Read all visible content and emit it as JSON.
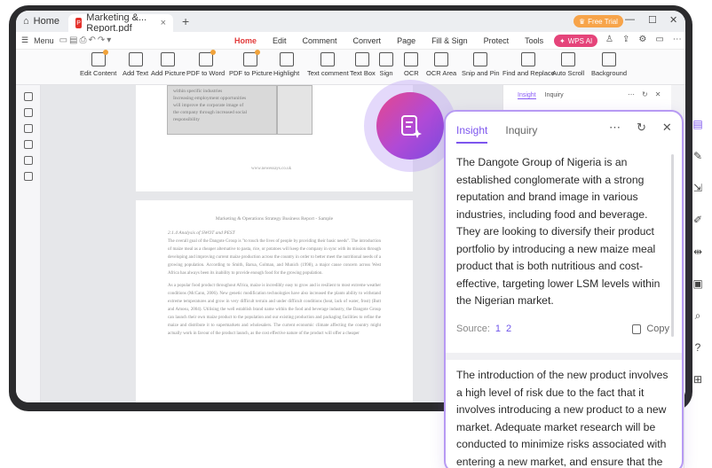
{
  "tabbar": {
    "home_label": "Home",
    "doc_tab_label": "Marketing &... Report.pdf",
    "free_trial": "Free Trial"
  },
  "menubar": {
    "menu_label": "Menu",
    "items": [
      "Home",
      "Edit",
      "Comment",
      "Convert",
      "Page",
      "Fill & Sign",
      "Protect",
      "Tools"
    ],
    "active": "Home",
    "wps_ai": "WPS AI"
  },
  "ribbon": {
    "buttons": [
      "Edit Content",
      "Add Text",
      "Add Picture",
      "PDF to Word",
      "PDF to Picture",
      "Highlight",
      "Text comment",
      "Text Box",
      "Sign",
      "OCR",
      "OCR Area",
      "Snip and Pin",
      "Find and Replace",
      "Auto Scroll",
      "Background"
    ]
  },
  "document": {
    "table_text": [
      "within specific industries",
      "Increasing employment opportunities",
      "will improve the corporate image of",
      "the company through increased social",
      "responsibility"
    ],
    "footer_url": "www.newessays.co.uk",
    "page2_header": "Marketing & Operations Strategy Business Report - Sample",
    "section_title": "2.1.4   Analysis of SWOT and PEST",
    "paragraph1": "The overall goal of the Dangote Group is \"to touch the lives of people by providing their basic needs\". The introduction of maize meal as a cheaper alternative to pasta, rice, or potatoes will keep the company in sync with its mission through developing and improving current maize production across the country in order to better meet the nutritional needs of a growing population. According to Smith, Barua, Golman, and Munich (1998), a major cause concern across West Africa has always been its inability to provide enough food for the growing population.",
    "paragraph2": "As a popular food product throughout Africa, maize is incredibly easy to grow and is resilient to most extreme weather conditions (McCann, 2006). New genetic modification technologies have also increased the plants ability to withstand extreme temperatures and grow in very difficult terrain and under difficult conditions (heat, lack of water, frost) (Butt and Amosu, 2004). Utilising the well establish brand name within the food and beverage industry, the Dangote Group can launch their own maize product to the population and our existing production and packaging facilities to refine the maize and distribute it to supermarkets and wholesalers. The current economic climate affecting the country might actually work in favour of the product launch, as the cost effective nature of the product will offer a cheaper"
  },
  "small_panel": {
    "tab_insight": "Insight",
    "tab_inquiry": "Inquiry"
  },
  "card": {
    "tab_insight": "Insight",
    "tab_inquiry": "Inquiry",
    "paragraph1": "The Dangote Group of Nigeria is an established conglomerate with a strong reputation and brand image in various industries, including food and beverage. They are looking to diversify their product portfolio by introducing a new maize meal product that is both nutritious and cost-effective, targeting lower LSM levels within the Nigerian market.",
    "source_label": "Source:",
    "source_1": "1",
    "source_2": "2",
    "copy_label": "Copy",
    "paragraph2": "The introduction of the new product involves a high level of risk due to the fact that it involves introducing a new product to a new market. Adequate market research will be conducted to minimize risks associated with entering a new market, and ensure that the product is sold at the right price, in the"
  },
  "colors": {
    "accent": "#7d55ee",
    "home_active": "#e23a3a",
    "wps_ai": "#e5447a",
    "trial": "#f7a44a"
  }
}
